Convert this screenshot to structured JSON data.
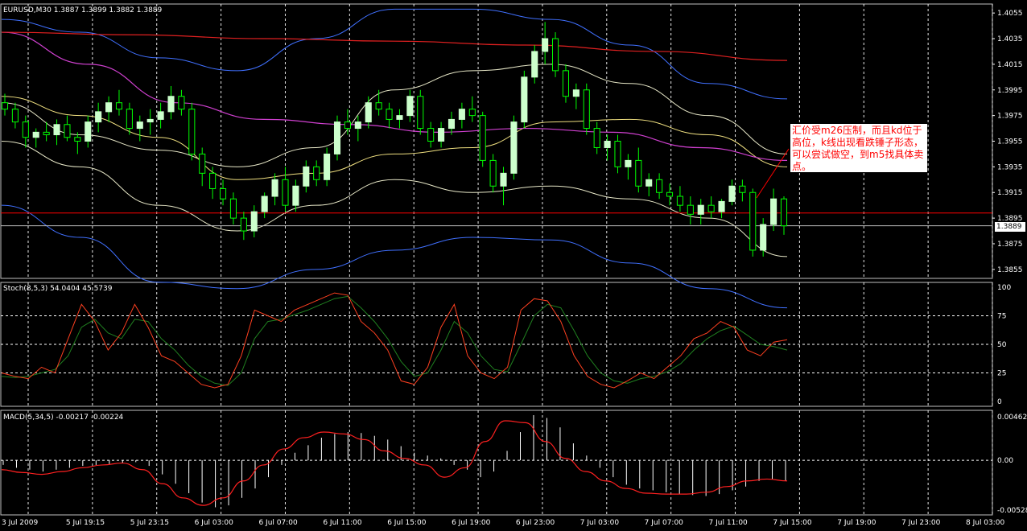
{
  "symbol_header": "EURUSD,M30  1.3887 1.3899 1.3882 1.3889",
  "annotation": "汇价受m26压制，而且kd位于高位，k线出现看跌锤子形态，可以尝试做空，到m5找具体卖点。",
  "current_price_label": "1.3889",
  "time_labels": [
    "3 Jul 2009",
    "5 Jul 19:15",
    "5 Jul 23:15",
    "6 Jul 03:00",
    "6 Jul 07:00",
    "6 Jul 11:00",
    "6 Jul 15:00",
    "6 Jul 19:00",
    "6 Jul 23:00",
    "7 Jul 03:00",
    "7 Jul 07:00",
    "7 Jul 11:00",
    "7 Jul 15:00",
    "7 Jul 19:00",
    "7 Jul 23:00",
    "8 Jul 03:00"
  ],
  "colors": {
    "bull": "#ccffcc",
    "wick": "#00ff00",
    "bear_outline": "#00ff00",
    "red_ma": "#e02020",
    "magenta_ma": "#d040d0",
    "white_band": "#e8e8c8",
    "yellow_mid": "#f0e080",
    "blue_band": "#4070ff",
    "stoch_k": "#ff4020",
    "stoch_d": "#208020",
    "macd_hist": "#ffffff",
    "macd_signal": "#ff2020",
    "grid": "#ffffff"
  },
  "chart_data": [
    {
      "type": "candlestick",
      "title": "EURUSD,M30",
      "ylabels": [
        "1.4055",
        "1.4035",
        "1.4015",
        "1.3995",
        "1.3975",
        "1.3955",
        "1.3935",
        "1.3915",
        "1.3895",
        "1.3875",
        "1.3855"
      ],
      "ylim": [
        1.3848,
        1.4062
      ],
      "hline_price": 1.3899,
      "current_price": 1.3889,
      "candles": [
        [
          1.3985,
          1.3992,
          1.3975,
          1.398
        ],
        [
          1.398,
          1.3985,
          1.3965,
          1.397
        ],
        [
          1.397,
          1.3975,
          1.395,
          1.3958
        ],
        [
          1.3958,
          1.3965,
          1.395,
          1.3962
        ],
        [
          1.3962,
          1.397,
          1.3955,
          1.396
        ],
        [
          1.396,
          1.3972,
          1.3952,
          1.3968
        ],
        [
          1.3968,
          1.3975,
          1.3955,
          1.3958
        ],
        [
          1.3958,
          1.3962,
          1.3945,
          1.3955
        ],
        [
          1.3955,
          1.3975,
          1.395,
          1.397
        ],
        [
          1.397,
          1.3985,
          1.3962,
          1.3978
        ],
        [
          1.3978,
          1.399,
          1.397,
          1.3985
        ],
        [
          1.3985,
          1.3995,
          1.3975,
          1.398
        ],
        [
          1.398,
          1.3985,
          1.396,
          1.3965
        ],
        [
          1.3965,
          1.3975,
          1.3955,
          1.397
        ],
        [
          1.397,
          1.398,
          1.396,
          1.3972
        ],
        [
          1.3972,
          1.3985,
          1.3965,
          1.3978
        ],
        [
          1.3978,
          1.3998,
          1.3972,
          1.399
        ],
        [
          1.399,
          1.3995,
          1.3975,
          1.398
        ],
        [
          1.398,
          1.3985,
          1.394,
          1.3945
        ],
        [
          1.3945,
          1.395,
          1.392,
          1.393
        ],
        [
          1.393,
          1.3935,
          1.391,
          1.3918
        ],
        [
          1.3918,
          1.3925,
          1.3905,
          1.391
        ],
        [
          1.391,
          1.3915,
          1.389,
          1.3895
        ],
        [
          1.3895,
          1.39,
          1.3878,
          1.3885
        ],
        [
          1.3885,
          1.3905,
          1.388,
          1.39
        ],
        [
          1.39,
          1.3915,
          1.3895,
          1.3912
        ],
        [
          1.3912,
          1.393,
          1.3905,
          1.3925
        ],
        [
          1.3925,
          1.3935,
          1.39,
          1.3905
        ],
        [
          1.3905,
          1.3925,
          1.39,
          1.392
        ],
        [
          1.392,
          1.394,
          1.3915,
          1.3935
        ],
        [
          1.3935,
          1.394,
          1.392,
          1.3925
        ],
        [
          1.3925,
          1.395,
          1.392,
          1.3945
        ],
        [
          1.3945,
          1.3975,
          1.394,
          1.397
        ],
        [
          1.397,
          1.398,
          1.396,
          1.3965
        ],
        [
          1.3965,
          1.3975,
          1.3955,
          1.397
        ],
        [
          1.397,
          1.399,
          1.3965,
          1.3985
        ],
        [
          1.3985,
          1.3995,
          1.3975,
          1.398
        ],
        [
          1.398,
          1.3985,
          1.3965,
          1.3972
        ],
        [
          1.3972,
          1.398,
          1.3965,
          1.3975
        ],
        [
          1.3975,
          1.3995,
          1.397,
          1.399
        ],
        [
          1.399,
          1.3995,
          1.396,
          1.3965
        ],
        [
          1.3965,
          1.397,
          1.395,
          1.3955
        ],
        [
          1.3955,
          1.397,
          1.395,
          1.3965
        ],
        [
          1.3965,
          1.3978,
          1.396,
          1.3972
        ],
        [
          1.3972,
          1.3985,
          1.3965,
          1.398
        ],
        [
          1.398,
          1.399,
          1.397,
          1.3975
        ],
        [
          1.3975,
          1.3978,
          1.3935,
          1.394
        ],
        [
          1.394,
          1.3945,
          1.3915,
          1.392
        ],
        [
          1.392,
          1.3935,
          1.3905,
          1.393
        ],
        [
          1.393,
          1.3975,
          1.3925,
          1.397
        ],
        [
          1.397,
          1.401,
          1.3965,
          1.4005
        ],
        [
          1.4005,
          1.403,
          1.4,
          1.4025
        ],
        [
          1.4025,
          1.4048,
          1.4015,
          1.4035
        ],
        [
          1.4035,
          1.404,
          1.4005,
          1.401
        ],
        [
          1.401,
          1.4015,
          1.3985,
          1.399
        ],
        [
          1.399,
          1.4,
          1.398,
          1.3995
        ],
        [
          1.3995,
          1.4,
          1.396,
          1.3965
        ],
        [
          1.3965,
          1.397,
          1.3945,
          1.395
        ],
        [
          1.395,
          1.396,
          1.394,
          1.3955
        ],
        [
          1.3955,
          1.396,
          1.393,
          1.3935
        ],
        [
          1.3935,
          1.3945,
          1.3925,
          1.394
        ],
        [
          1.394,
          1.395,
          1.3915,
          1.392
        ],
        [
          1.392,
          1.393,
          1.3912,
          1.3925
        ],
        [
          1.3925,
          1.393,
          1.391,
          1.3915
        ],
        [
          1.3915,
          1.3922,
          1.3905,
          1.3912
        ],
        [
          1.3912,
          1.392,
          1.39,
          1.3905
        ],
        [
          1.3905,
          1.3912,
          1.389,
          1.3898
        ],
        [
          1.3898,
          1.391,
          1.389,
          1.3905
        ],
        [
          1.3905,
          1.3912,
          1.3895,
          1.39
        ],
        [
          1.39,
          1.391,
          1.3895,
          1.3908
        ],
        [
          1.3908,
          1.3925,
          1.3905,
          1.392
        ],
        [
          1.392,
          1.3925,
          1.3908,
          1.3915
        ],
        [
          1.3915,
          1.3918,
          1.3865,
          1.387
        ],
        [
          1.387,
          1.3895,
          1.3865,
          1.389
        ],
        [
          1.389,
          1.3918,
          1.3885,
          1.391
        ],
        [
          1.391,
          1.3912,
          1.3882,
          1.3889
        ]
      ],
      "red_ma": [
        1.404,
        1.4038,
        1.4035,
        1.4033,
        1.403,
        1.4025,
        1.4018
      ],
      "magenta_ma": [
        1.404,
        1.4015,
        1.3985,
        1.3972,
        1.3968,
        1.3962,
        1.3965,
        1.3962,
        1.395,
        1.394
      ],
      "white_upper": [
        1.3985,
        1.396,
        1.3948,
        1.3935,
        1.395,
        1.3995,
        1.401,
        1.4015,
        1.4,
        1.3975,
        1.3945
      ],
      "yellow_mid": [
        1.399,
        1.3975,
        1.3958,
        1.3925,
        1.393,
        1.3945,
        1.395,
        1.397,
        1.3972,
        1.396,
        1.3935
      ],
      "white_lower": [
        1.3955,
        1.3935,
        1.3905,
        1.3885,
        1.3905,
        1.3925,
        1.3915,
        1.392,
        1.391,
        1.3895,
        1.3865
      ],
      "blue_upper": [
        1.405,
        1.404,
        1.402,
        1.401,
        1.4035,
        1.4058,
        1.4058,
        1.405,
        1.403,
        1.4,
        1.3988
      ],
      "blue_lower": [
        1.3905,
        1.388,
        1.3845,
        1.384,
        1.3855,
        1.387,
        1.388,
        1.3878,
        1.386,
        1.384,
        1.3825
      ]
    },
    {
      "type": "line",
      "title": "Stoch(8,5,3) 54.0404 45.5739",
      "ylabels": [
        "100",
        "75",
        "50",
        "25",
        "0"
      ],
      "ylim": [
        0,
        100
      ],
      "k": [
        25,
        22,
        20,
        30,
        25,
        55,
        85,
        70,
        45,
        60,
        85,
        65,
        40,
        35,
        25,
        15,
        12,
        15,
        40,
        80,
        75,
        70,
        80,
        85,
        90,
        95,
        93,
        70,
        60,
        45,
        18,
        15,
        30,
        65,
        85,
        40,
        25,
        20,
        30,
        80,
        90,
        88,
        70,
        40,
        22,
        15,
        12,
        18,
        25,
        20,
        30,
        40,
        55,
        60,
        70,
        65,
        45,
        40,
        52,
        54
      ],
      "d": [
        22,
        21,
        22,
        25,
        28,
        40,
        65,
        72,
        60,
        55,
        72,
        70,
        55,
        45,
        32,
        22,
        16,
        14,
        25,
        55,
        70,
        72,
        76,
        80,
        85,
        90,
        92,
        82,
        70,
        55,
        35,
        22,
        25,
        45,
        70,
        60,
        40,
        28,
        26,
        50,
        75,
        85,
        82,
        62,
        40,
        25,
        18,
        16,
        20,
        22,
        26,
        33,
        45,
        55,
        62,
        66,
        58,
        50,
        48,
        45
      ]
    },
    {
      "type": "bar",
      "title": "MACD(5,34,5) -0.00217 -0.00224",
      "ylabels": [
        "0.00462",
        "0.00",
        "-0.00528"
      ],
      "ylim": [
        -0.0053,
        0.0048
      ],
      "histogram": [
        -0.0005,
        -0.0008,
        -0.001,
        -0.0012,
        -0.001,
        -0.0008,
        -0.0006,
        -0.0005,
        -0.0004,
        -0.0003,
        -0.0002,
        -0.0006,
        -0.0015,
        -0.0025,
        -0.0035,
        -0.0045,
        -0.005,
        -0.0048,
        -0.004,
        -0.003,
        -0.0018,
        -0.0005,
        0.0008,
        0.0016,
        0.0024,
        0.0028,
        0.003,
        0.0029,
        0.0026,
        0.0022,
        0.0015,
        0.0008,
        0.0005,
        0.0002,
        -0.0005,
        -0.001,
        -0.0018,
        -0.0012,
        0.001,
        0.003,
        0.0048,
        0.0045,
        0.0035,
        0.0018,
        0.0005,
        -0.0008,
        -0.0018,
        -0.0026,
        -0.003,
        -0.0032,
        -0.0034,
        -0.0036,
        -0.0037,
        -0.0038,
        -0.0036,
        -0.0032,
        -0.0028,
        -0.0022,
        -0.002,
        -0.0022
      ],
      "signal": [
        -0.001,
        -0.0013,
        -0.0015,
        -0.0012,
        -0.0008,
        -0.0005,
        -0.0003,
        -0.001,
        -0.0025,
        -0.004,
        -0.0048,
        -0.004,
        -0.0022,
        -0.0005,
        0.0012,
        0.0024,
        0.003,
        0.0028,
        0.0022,
        0.001,
        0.0002,
        -0.0005,
        -0.0018,
        -0.0008,
        0.002,
        0.0042,
        0.004,
        0.002,
        0.0002,
        -0.0012,
        -0.0022,
        -0.003,
        -0.0035,
        -0.0036,
        -0.0036,
        -0.0034,
        -0.0028,
        -0.0022,
        -0.002,
        -0.0022
      ]
    }
  ]
}
